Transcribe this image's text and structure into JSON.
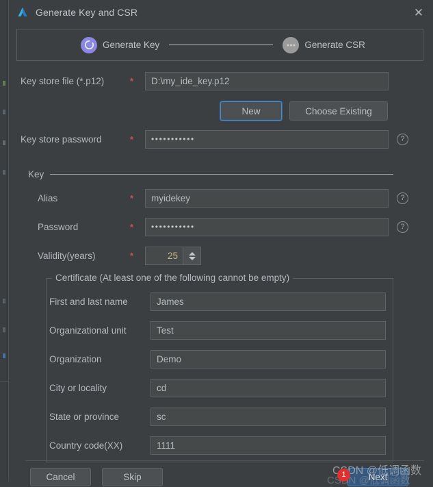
{
  "window": {
    "title": "Generate Key and CSR",
    "app_icon": "android-studio-icon",
    "close_icon": "close-icon",
    "background": "#3C3F41"
  },
  "wizard": {
    "steps": [
      {
        "label": "Generate Key",
        "state": "active",
        "icon": "spinner-circle-icon",
        "color": "#8C87E0"
      },
      {
        "label": "Generate CSR",
        "state": "inactive",
        "icon": "ellipsis-circle-icon",
        "color": "#9A9A9A"
      }
    ]
  },
  "form": {
    "keystore_file": {
      "label": "Key store file (*.p12)",
      "required": "*",
      "value": "D:\\my_ide_key.p12"
    },
    "new_button": {
      "label": "New",
      "focused": true
    },
    "choose_existing_button": {
      "label": "Choose Existing"
    },
    "keystore_password": {
      "label": "Key store password",
      "required": "*",
      "value": "•••••••••••",
      "help_icon": "help-circle-icon"
    }
  },
  "key_section": {
    "title": "Key",
    "alias": {
      "label": "Alias",
      "required": "*",
      "value": "myidekey",
      "help_icon": "help-circle-icon"
    },
    "password": {
      "label": "Password",
      "required": "*",
      "value": "•••••••••••",
      "help_icon": "help-circle-icon"
    },
    "validity": {
      "label": "Validity(years)",
      "required": "*",
      "value": "25"
    }
  },
  "certificate": {
    "legend": "Certificate (At least one of the following cannot be empty)",
    "fields": [
      {
        "label": "First and last name",
        "value": "James"
      },
      {
        "label": "Organizational unit",
        "value": "Test"
      },
      {
        "label": "Organization",
        "value": "Demo"
      },
      {
        "label": "City or locality",
        "value": "cd"
      },
      {
        "label": "State or province",
        "value": "sc"
      },
      {
        "label": "Country code(XX)",
        "value": "1111"
      }
    ]
  },
  "footer": {
    "cancel": "Cancel",
    "skip": "Skip",
    "next": "Next",
    "badge": "1"
  },
  "watermark": {
    "text": "CSDN @低调函数",
    "ghost": "CSDN @低调函数"
  }
}
